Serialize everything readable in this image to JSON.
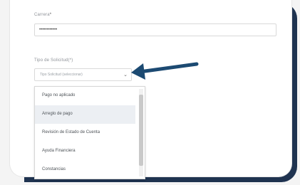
{
  "form": {
    "carrera_label": "Carrera",
    "carrera_value": "••••••••••••",
    "tipo_label": "Tipo de Solicitud(*)",
    "tipo_placeholder": "Tipo Solicitud (seleccionar)"
  },
  "dropdown": {
    "options": [
      "Pago no aplicado",
      "Arreglo de pago",
      "Revisión de Estado de Cuenta",
      "Ayuda Financiera",
      "Constancias"
    ],
    "selected_index": 1
  },
  "colors": {
    "frame": "#1f3350",
    "arrow": "#1c4a72"
  }
}
